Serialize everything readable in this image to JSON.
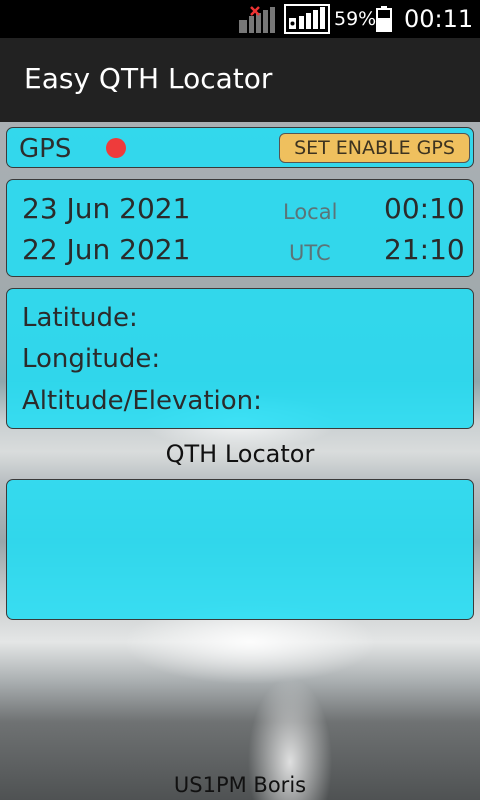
{
  "status_bar": {
    "battery_percent": "59%",
    "time": "00:11",
    "icons": [
      "signal-no-service-icon",
      "signal-strength-icon",
      "battery-icon"
    ]
  },
  "app_bar": {
    "title": "Easy QTH Locator"
  },
  "gps": {
    "label": "GPS",
    "status_color": "#ee3b3b",
    "enable_button_label": "SET ENABLE GPS"
  },
  "time": {
    "local_date": "23 Jun 2021",
    "local_label": "Local",
    "local_time": "00:10",
    "utc_date": "22 Jun 2021",
    "utc_label": "UTC",
    "utc_time": "21:10"
  },
  "coords": {
    "latitude_label": "Latitude:",
    "longitude_label": "Longitude:",
    "altitude_label": "Altitude/Elevation:"
  },
  "locator": {
    "caption": "QTH Locator"
  },
  "footer": {
    "author": "US1PM Boris"
  },
  "colors": {
    "panel": "#22ddf4",
    "button": "#efc05e",
    "app_bar": "#222222"
  }
}
